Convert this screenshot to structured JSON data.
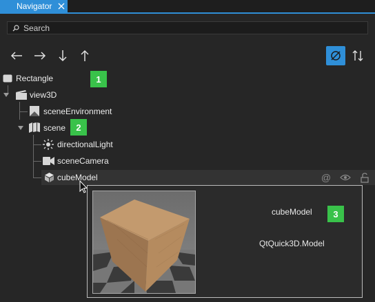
{
  "panel": {
    "tab_title": "Navigator",
    "tab_close_icon": "close-icon"
  },
  "search": {
    "placeholder": "Search",
    "icon": "search-icon"
  },
  "toolbar": {
    "buttons": [
      {
        "name": "move-left-button",
        "icon": "arrow-left-icon",
        "glyph": "←"
      },
      {
        "name": "move-right-button",
        "icon": "arrow-right-icon",
        "glyph": "→"
      },
      {
        "name": "move-down-button",
        "icon": "arrow-down-icon",
        "glyph": "↓"
      },
      {
        "name": "move-up-button",
        "icon": "arrow-up-icon",
        "glyph": "↑"
      },
      {
        "name": "filter-toggle-button",
        "icon": "filter-off-icon",
        "active": true
      },
      {
        "name": "sort-button",
        "icon": "sort-icon",
        "glyph": "⇅"
      }
    ]
  },
  "tree": {
    "nodes": [
      {
        "label": "Rectangle",
        "icon": "rectangle-icon"
      },
      {
        "label": "view3D",
        "icon": "view3d-icon",
        "expanded": true
      },
      {
        "label": "sceneEnvironment",
        "icon": "scene-environment-icon"
      },
      {
        "label": "scene",
        "icon": "scene-node-icon",
        "expanded": true
      },
      {
        "label": "directionalLight",
        "icon": "light-icon"
      },
      {
        "label": "sceneCamera",
        "icon": "camera-icon"
      },
      {
        "label": "cubeModel",
        "icon": "model-icon",
        "selected": true
      }
    ],
    "row_actions": [
      {
        "name": "alias-export-toggle",
        "icon": "at-icon",
        "glyph": "@"
      },
      {
        "name": "visibility-toggle",
        "icon": "eye-icon"
      },
      {
        "name": "lock-toggle",
        "icon": "unlock-icon"
      }
    ]
  },
  "tooltip": {
    "id_text": "cubeModel",
    "type_text": "QtQuick3D.Model"
  },
  "callouts": [
    "1",
    "2",
    "3"
  ],
  "colors": {
    "accent": "#2f8fd8",
    "badge": "#39c24a",
    "background": "#262626"
  }
}
